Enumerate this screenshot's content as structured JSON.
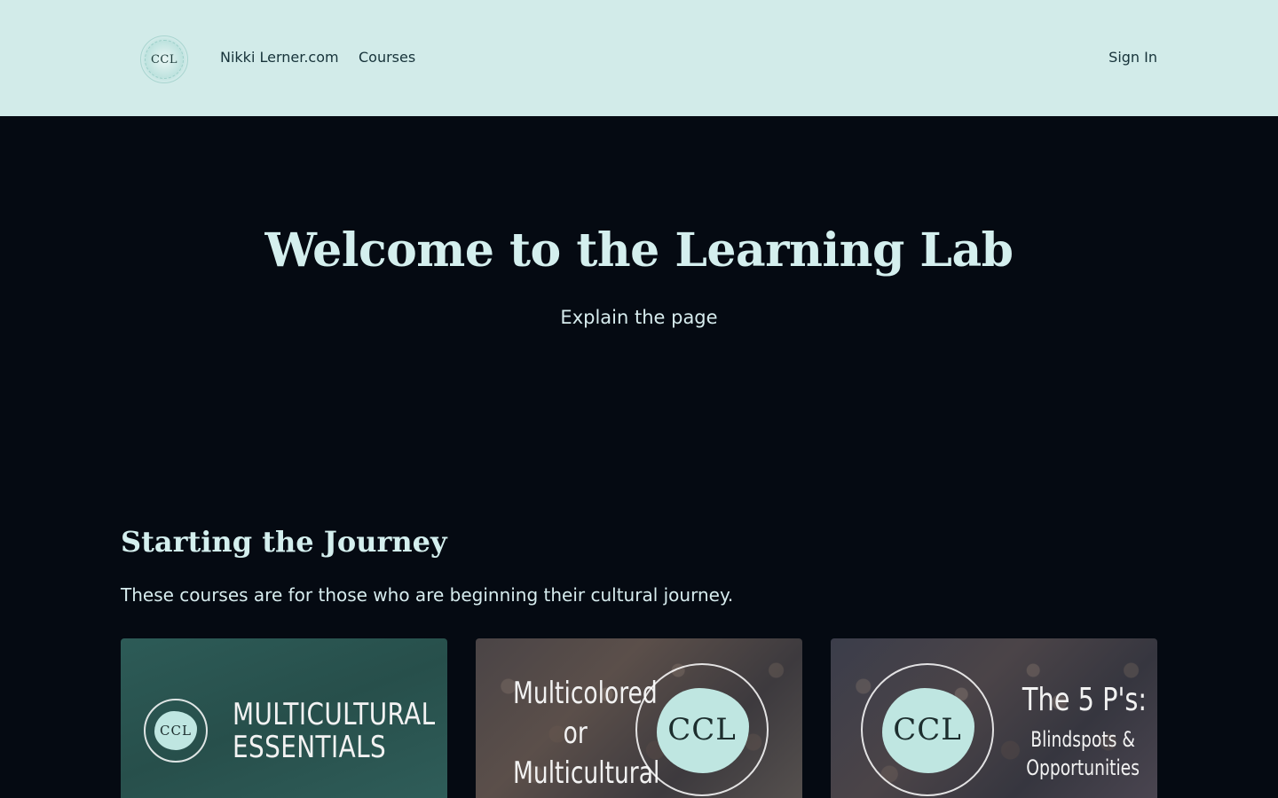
{
  "header": {
    "logo_text": "CCL",
    "nav": {
      "site_link": "Nikki Lerner.com",
      "courses_link": "Courses",
      "sign_in": "Sign In"
    }
  },
  "hero": {
    "title": "Welcome to the Learning Lab",
    "subtitle": "Explain the page"
  },
  "section": {
    "title": "Starting the Journey",
    "description": "These courses are for those who are beginning their cultural journey.",
    "courses": [
      {
        "badge_text": "CCL",
        "title_line1": "MULTICULTURAL",
        "title_line2": "ESSENTIALS"
      },
      {
        "badge_text": "CCL",
        "title_line1": "Multicolored",
        "title_line2": "or",
        "title_line3": "Multicultural"
      },
      {
        "badge_text": "CCL",
        "title_line1": "The 5 P's:",
        "subtitle_line1": "Blindspots &",
        "subtitle_line2": "Opportunities"
      }
    ]
  },
  "colors": {
    "header_bg": "#d2ebe9",
    "page_bg": "#050a12",
    "heading": "#d4efee",
    "accent_teal": "#bfe6e1"
  }
}
